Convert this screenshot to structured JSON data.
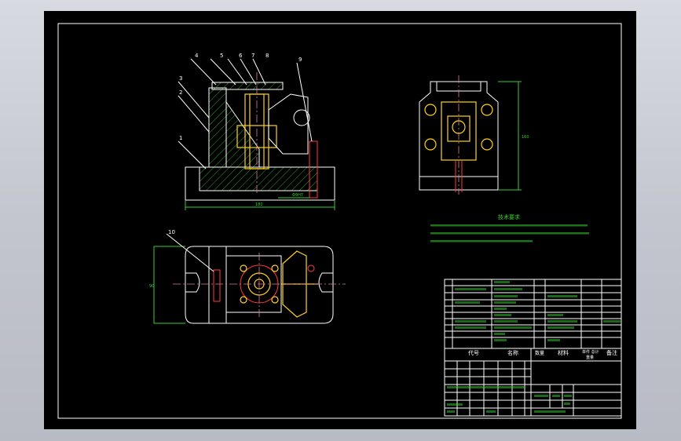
{
  "title_block": {
    "header_code": "代号",
    "header_name": "名称",
    "header_qty": "数量",
    "header_material": "材料",
    "header_weight": "单件 总计",
    "header_weight_sub": "重量",
    "header_note": "备注"
  },
  "tech_requirements": {
    "title": "技术要求"
  },
  "colors": {
    "outline": "#ffffff",
    "dimension": "#35d12e",
    "bolt": "#ffd21a",
    "hidden": "#ff3a3a",
    "centerline": "#e07aa0",
    "background": "#000000"
  }
}
